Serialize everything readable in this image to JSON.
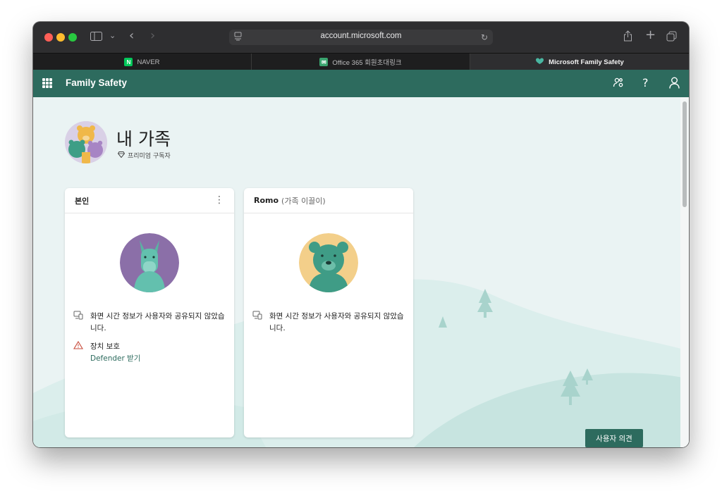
{
  "browser": {
    "url": "account.microsoft.com",
    "tabs": [
      {
        "label": "NAVER"
      },
      {
        "label": "Office 365 회원초대링크"
      },
      {
        "label": "Microsoft Family Safety"
      }
    ]
  },
  "app": {
    "title": "Family Safety"
  },
  "page": {
    "title": "내 가족",
    "subscription": "프리미엄 구독자"
  },
  "cards": [
    {
      "name": "본인",
      "role": "",
      "screen_time": "화면 시간 정보가 사용자와 공유되지 않았습니다.",
      "device_label": "장치 보호",
      "device_link": "Defender 받기"
    },
    {
      "name": "Romo",
      "role": "(가족 이끌이)",
      "screen_time": "화면 시간 정보가 사용자와 공유되지 않았습니다."
    }
  ],
  "feedback": "사용자 의견",
  "colors": {
    "brand": "#2d6b5e",
    "content_bg": "#eaf3f3"
  }
}
